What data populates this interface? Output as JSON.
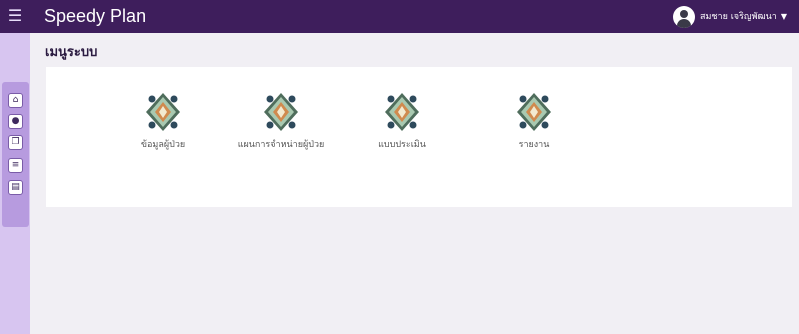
{
  "header": {
    "app_title": "Speedy Plan",
    "user_name": "สมชาย เจริญพัฒนา"
  },
  "page": {
    "title": "เมนูระบบ"
  },
  "menu": [
    {
      "label": "ข้อมูลผู้ป่วย"
    },
    {
      "label": "แผนการจำหน่ายผู้ป่วย"
    },
    {
      "label": "แบบประเมิน"
    },
    {
      "label": "รายงาน"
    }
  ],
  "sidebar": {
    "items": [
      "home-icon",
      "user-icon",
      "copy-icon",
      "list-icon",
      "document-icon"
    ]
  },
  "colors": {
    "topbar": "#3e1e5c",
    "sidebar": "#d7c5f0",
    "background": "#f1eff4"
  }
}
